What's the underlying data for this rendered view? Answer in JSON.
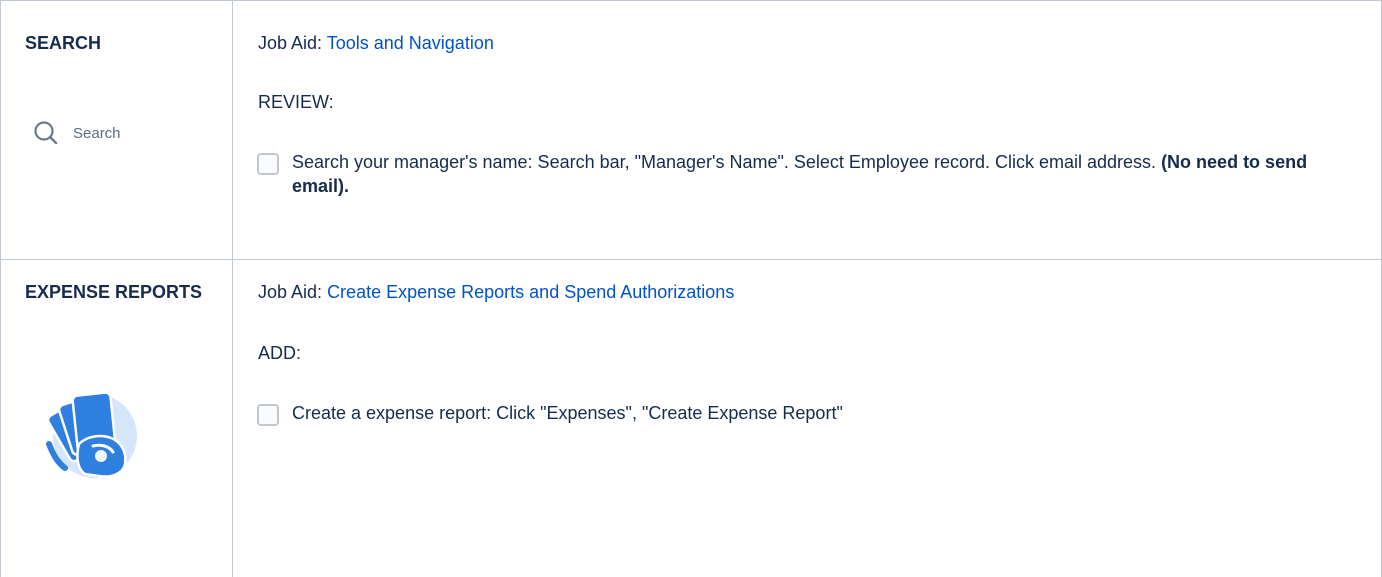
{
  "sections": [
    {
      "title": "SEARCH",
      "search_widget": {
        "icon": "search-icon",
        "label": "Search"
      },
      "job_aid_prefix": "Job Aid:",
      "job_aid_link": "Tools and Navigation",
      "subhead": "REVIEW:",
      "task": {
        "text": "Search your manager's name: Search bar, \"Manager's Name\". Select Employee record. Click email address.",
        "bold": "(No need to send email).",
        "checked": false
      }
    },
    {
      "title": "EXPENSE REPORTS",
      "illustration": "hand-holding-cards-icon",
      "job_aid_prefix": "Job Aid:",
      "job_aid_link": "Create Expense Reports and Spend Authorizations",
      "subhead": "ADD:",
      "task": {
        "text": "Create a expense report: Click \"Expenses\", \"Create Expense Report\"",
        "checked": false
      }
    }
  ],
  "colors": {
    "text": "#172b4d",
    "link": "#0052cc",
    "border": "#c1c7d0",
    "illustration_blue": "#2f7fe0",
    "illustration_bg": "#d6e6fa"
  }
}
